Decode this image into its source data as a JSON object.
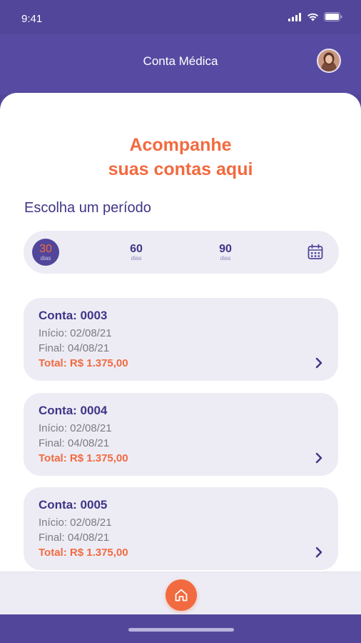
{
  "status_bar": {
    "time": "9:41"
  },
  "header": {
    "title": "Conta Médica"
  },
  "headline": {
    "line1": "Acompanhe",
    "line2": "suas contas aqui"
  },
  "period": {
    "title": "Escolha um período",
    "options": [
      {
        "value": "30",
        "unit": "dias",
        "selected": true
      },
      {
        "value": "60",
        "unit": "dias",
        "selected": false
      },
      {
        "value": "90",
        "unit": "dias",
        "selected": false
      }
    ],
    "calendar_icon": "calendar-icon"
  },
  "accounts": [
    {
      "title": "Conta: 0003",
      "start": "Início: 02/08/21",
      "end": "Final: 04/08/21",
      "total": "Total: R$ 1.375,00"
    },
    {
      "title": "Conta: 0004",
      "start": "Início: 02/08/21",
      "end": "Final: 04/08/21",
      "total": "Total: R$ 1.375,00"
    },
    {
      "title": "Conta: 0005",
      "start": "Início: 02/08/21",
      "end": "Final: 04/08/21",
      "total": "Total: R$ 1.375,00"
    }
  ],
  "bottom_nav": {
    "home_icon": "home-icon"
  },
  "colors": {
    "primary": "#52469a",
    "accent": "#f26a3f",
    "card": "#edecf5",
    "text_dark": "#3e3587"
  }
}
